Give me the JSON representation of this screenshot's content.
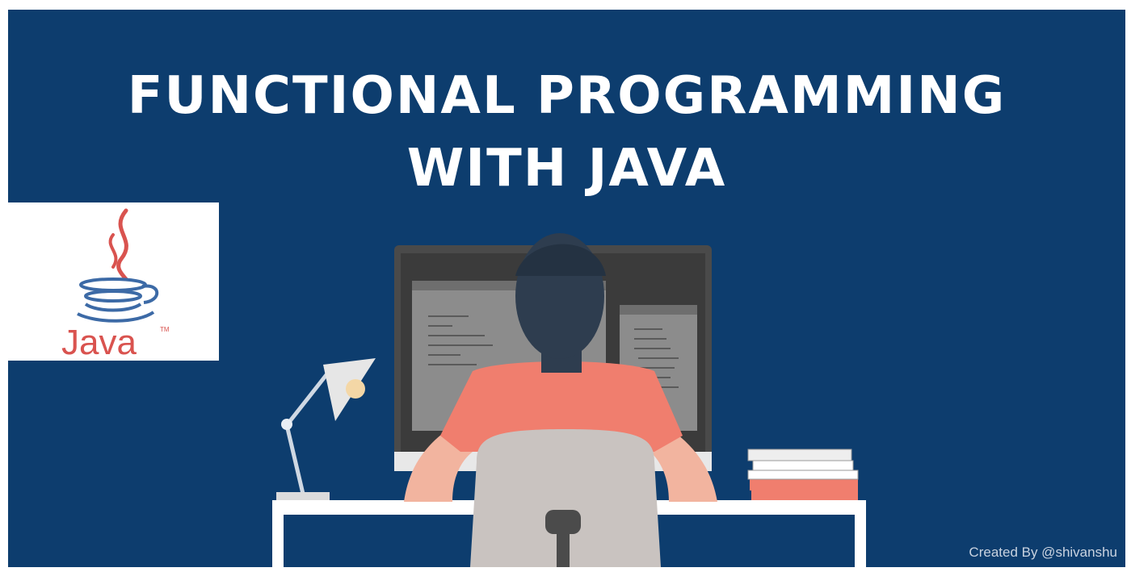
{
  "banner": {
    "title_line1": "FUNCTIONAL PROGRAMMING",
    "title_line2": "WITH JAVA",
    "credit": "Created By @shivanshu",
    "background_color": "#0d3d6e"
  },
  "logo": {
    "text": "Java",
    "trademark": "TM",
    "cup_color": "#3c6aa6",
    "steam_color": "#d9534f",
    "text_color": "#d9534f"
  },
  "illustration": {
    "icon_name": "developer-at-desk-illustration",
    "shirt_color": "#f07e6e",
    "monitor_color": "#555555",
    "desk_color": "#ffffff"
  }
}
